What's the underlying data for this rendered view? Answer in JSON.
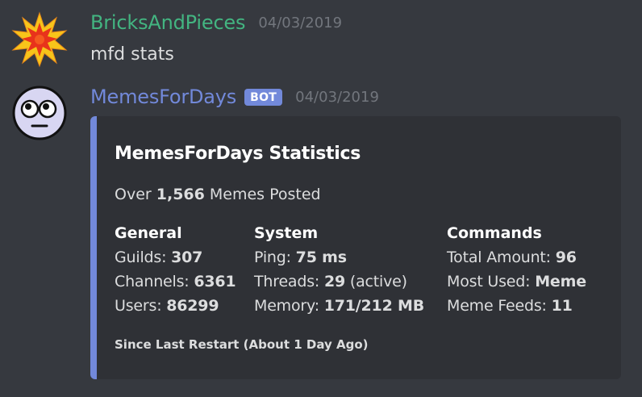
{
  "messages": [
    {
      "username": "BricksAndPieces",
      "username_color": "#43b581",
      "timestamp": "04/03/2019",
      "content": "mfd stats",
      "avatar_icon": "explosion-icon"
    },
    {
      "username": "MemesForDays",
      "username_color": "#7289da",
      "bot_tag": "BOT",
      "timestamp": "04/03/2019",
      "avatar_icon": "face-emoji-icon"
    }
  ],
  "embed": {
    "accent_color": "#7289da",
    "title": "MemesForDays Statistics",
    "description_prefix": "Over ",
    "description_value": "1,566",
    "description_suffix": " Memes Posted",
    "fields": [
      {
        "name": "General",
        "lines": [
          {
            "label": "Guilds: ",
            "value": "307",
            "suffix": ""
          },
          {
            "label": "Channels: ",
            "value": "6361",
            "suffix": ""
          },
          {
            "label": "Users: ",
            "value": "86299",
            "suffix": ""
          }
        ]
      },
      {
        "name": "System",
        "lines": [
          {
            "label": "Ping: ",
            "value": "75 ms",
            "suffix": ""
          },
          {
            "label": "Threads: ",
            "value": "29",
            "suffix": " (active)"
          },
          {
            "label": "Memory: ",
            "value": "171/212 MB",
            "suffix": ""
          }
        ]
      },
      {
        "name": "Commands",
        "lines": [
          {
            "label": "Total Amount: ",
            "value": "96",
            "suffix": ""
          },
          {
            "label": "Most Used: ",
            "value": "Meme",
            "suffix": ""
          },
          {
            "label": "Meme Feeds: ",
            "value": "11",
            "suffix": ""
          }
        ]
      }
    ],
    "footer": "Since Last Restart (About 1 Day Ago)"
  }
}
